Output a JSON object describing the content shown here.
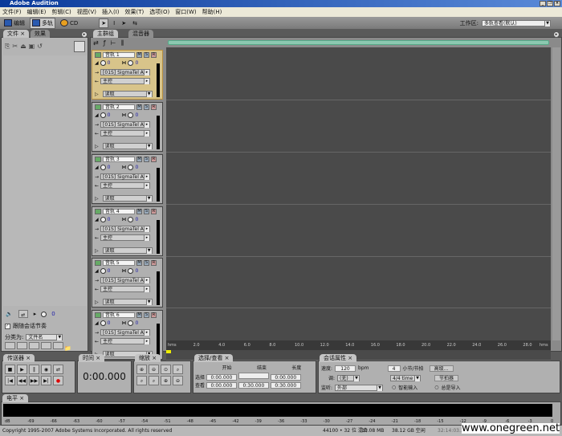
{
  "title": "Adobe Audition",
  "menu": [
    "文件(F)",
    "编辑(E)",
    "剪辑(C)",
    "视图(V)",
    "插入(I)",
    "效果(T)",
    "选项(O)",
    "窗口(W)",
    "帮助(H)"
  ],
  "toolbar": {
    "edit": "编辑",
    "multitrack": "多轨",
    "cd": "CD",
    "workspace_label": "工作区:",
    "workspace_value": "多轨查看(默认)"
  },
  "left_panel": {
    "tabs": [
      "文件",
      "效果"
    ],
    "follow_label": "跟随会话节奏",
    "volume": "0",
    "sort_label": "分类为:",
    "sort_value": "文件名"
  },
  "main": {
    "tabs": [
      "主群组",
      "混音器"
    ]
  },
  "tracks": [
    {
      "name": "音轨 1",
      "vol": "0",
      "pan": "0",
      "input": "[01S] SigmaTel Au",
      "output": "主控",
      "mode": "读取"
    },
    {
      "name": "音轨 2",
      "vol": "0",
      "pan": "0",
      "input": "[01S] SigmaTel Au",
      "output": "主控",
      "mode": "读取"
    },
    {
      "name": "音轨 3",
      "vol": "0",
      "pan": "0",
      "input": "[01S] SigmaTel Au",
      "output": "主控",
      "mode": "读取"
    },
    {
      "name": "音轨 4",
      "vol": "0",
      "pan": "0",
      "input": "[01S] SigmaTel Au",
      "output": "主控",
      "mode": "读取"
    },
    {
      "name": "音轨 5",
      "vol": "0",
      "pan": "0",
      "input": "[01S] SigmaTel Au",
      "output": "主控",
      "mode": "读取"
    },
    {
      "name": "音轨 6",
      "vol": "0",
      "pan": "0",
      "input": "[01S] SigmaTel Au",
      "output": "主控",
      "mode": "读取"
    }
  ],
  "track_buttons": {
    "m": "M",
    "s": "S",
    "r": "R"
  },
  "ruler": [
    "hms",
    "2.0",
    "4.0",
    "6.0",
    "8.0",
    "10.0",
    "12.0",
    "14.0",
    "16.0",
    "18.0",
    "20.0",
    "22.0",
    "24.0",
    "26.0",
    "28.0",
    "hms"
  ],
  "transport": {
    "tab": "传送器"
  },
  "time": {
    "tab": "时间",
    "value": "0:00.000"
  },
  "zoom": {
    "tab": "缩放"
  },
  "selection": {
    "tab": "选择/查看",
    "cols": [
      "开始",
      "结束",
      "长度"
    ],
    "rows": [
      {
        "label": "选择",
        "start": "0:00.000",
        "end": "",
        "length": "0:00.000"
      },
      {
        "label": "查看",
        "start": "0:00.000",
        "end": "0:30.000",
        "length": "0:30.000"
      }
    ]
  },
  "session": {
    "tab": "会话属性",
    "tempo_label": "速度:",
    "tempo": "120",
    "bpm": "bpm",
    "beats": "4",
    "beats_label": "小节/节拍",
    "advanced": "高级...",
    "key_label": "调:",
    "key": "(无)",
    "time_sig": "4/4 time",
    "metronome": "节拍器",
    "monitor_label": "监听:",
    "monitor": "外部",
    "smart_input": "智能输入",
    "always_import": "总是导入"
  },
  "levels": {
    "tab": "电平",
    "ticks": [
      "dB",
      "-69",
      "-66",
      "-63",
      "-60",
      "-57",
      "-54",
      "-51",
      "-48",
      "-45",
      "-42",
      "-39",
      "-36",
      "-33",
      "-30",
      "-27",
      "-24",
      "-21",
      "-18",
      "-15",
      "-12",
      "-9",
      "-6",
      "-3",
      "0"
    ]
  },
  "status": {
    "copyright": "Copyright 1995-2007 Adobe Systems Incorporated. All rights reserved",
    "format": "44100 • 32 位 混合",
    "size": "10.08 MB",
    "free": "38.12 GB 空闲",
    "time_free": "32:14:03.3 空闲",
    "watermark": "www.onegreen.net"
  }
}
